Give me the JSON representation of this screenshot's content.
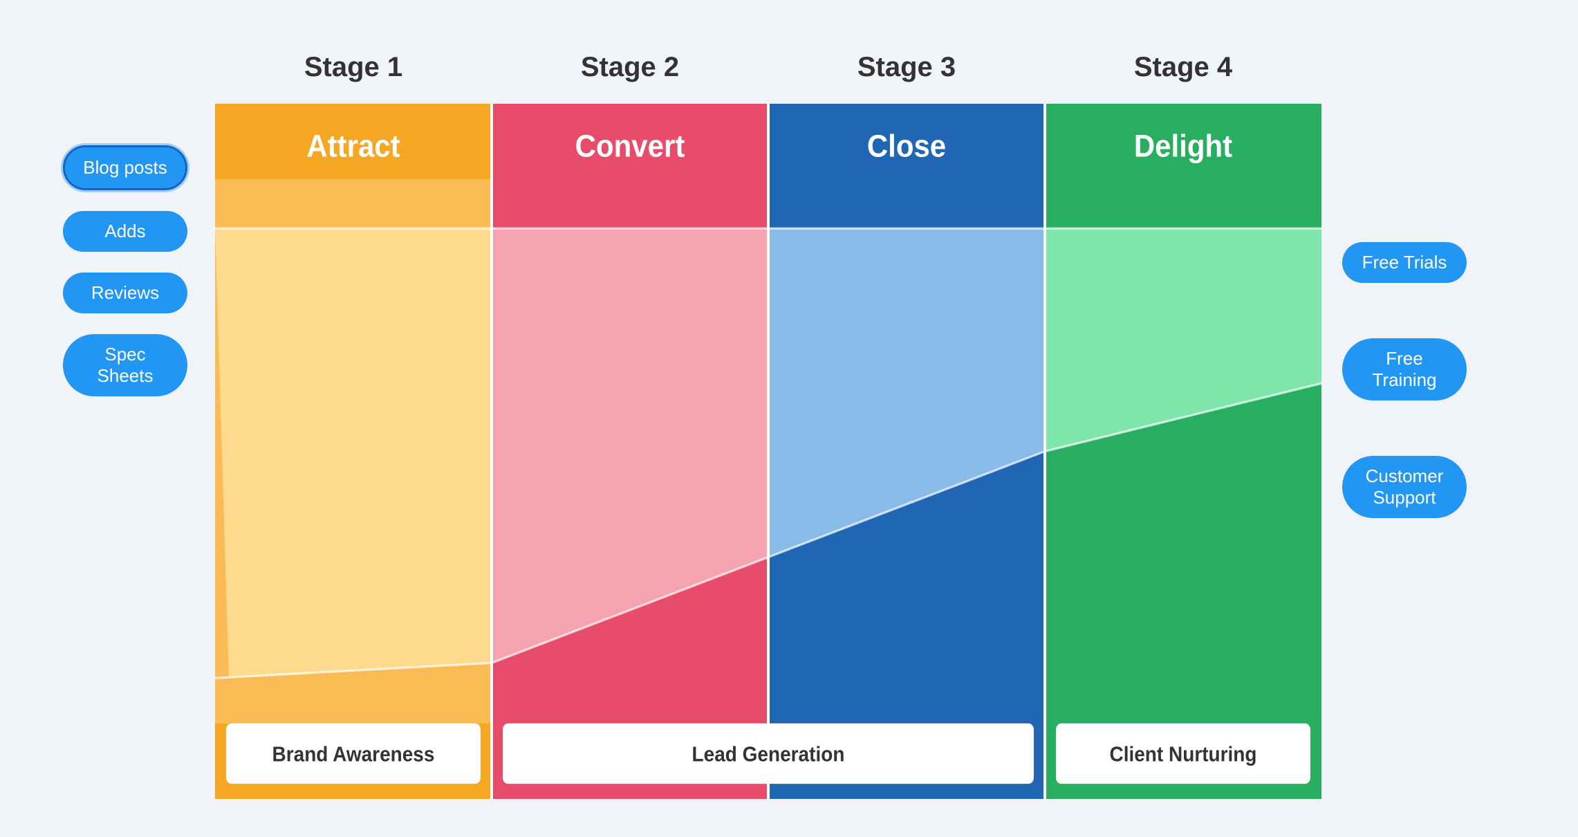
{
  "stages": [
    {
      "id": "stage1",
      "label": "Stage 1",
      "name": "Attract",
      "bottomLabel": "Brand Awareness",
      "colorDark": "#F5A623",
      "colorLight": "#FABB55",
      "colorPale": "#FDDA8E"
    },
    {
      "id": "stage2",
      "label": "Stage 2",
      "name": "Convert",
      "bottomLabel": "Lead Generation",
      "colorDark": "#E84C6B",
      "colorLight": "#EF7089",
      "colorPale": "#F5A3B0"
    },
    {
      "id": "stage3",
      "label": "Stage 3",
      "name": "Close",
      "bottomLabel": "",
      "colorDark": "#2166B5",
      "colorLight": "#4A90D9",
      "colorPale": "#89BBE8"
    },
    {
      "id": "stage4",
      "label": "Stage 4",
      "name": "Delight",
      "bottomLabel": "Client Nurturing",
      "colorDark": "#27AE60",
      "colorLight": "#2ECC71",
      "colorPale": "#7FE5AB"
    }
  ],
  "leftButtons": [
    {
      "id": "blog-posts",
      "label": "Blog posts",
      "selected": true
    },
    {
      "id": "adds",
      "label": "Adds",
      "selected": false
    },
    {
      "id": "reviews",
      "label": "Reviews",
      "selected": false
    },
    {
      "id": "spec-sheets",
      "label": "Spec Sheets",
      "selected": false
    }
  ],
  "rightButtons": [
    {
      "id": "free-trials",
      "label": "Free Trials"
    },
    {
      "id": "free-training",
      "label": "Free Training"
    },
    {
      "id": "customer-support",
      "label": "Customer Support"
    }
  ]
}
